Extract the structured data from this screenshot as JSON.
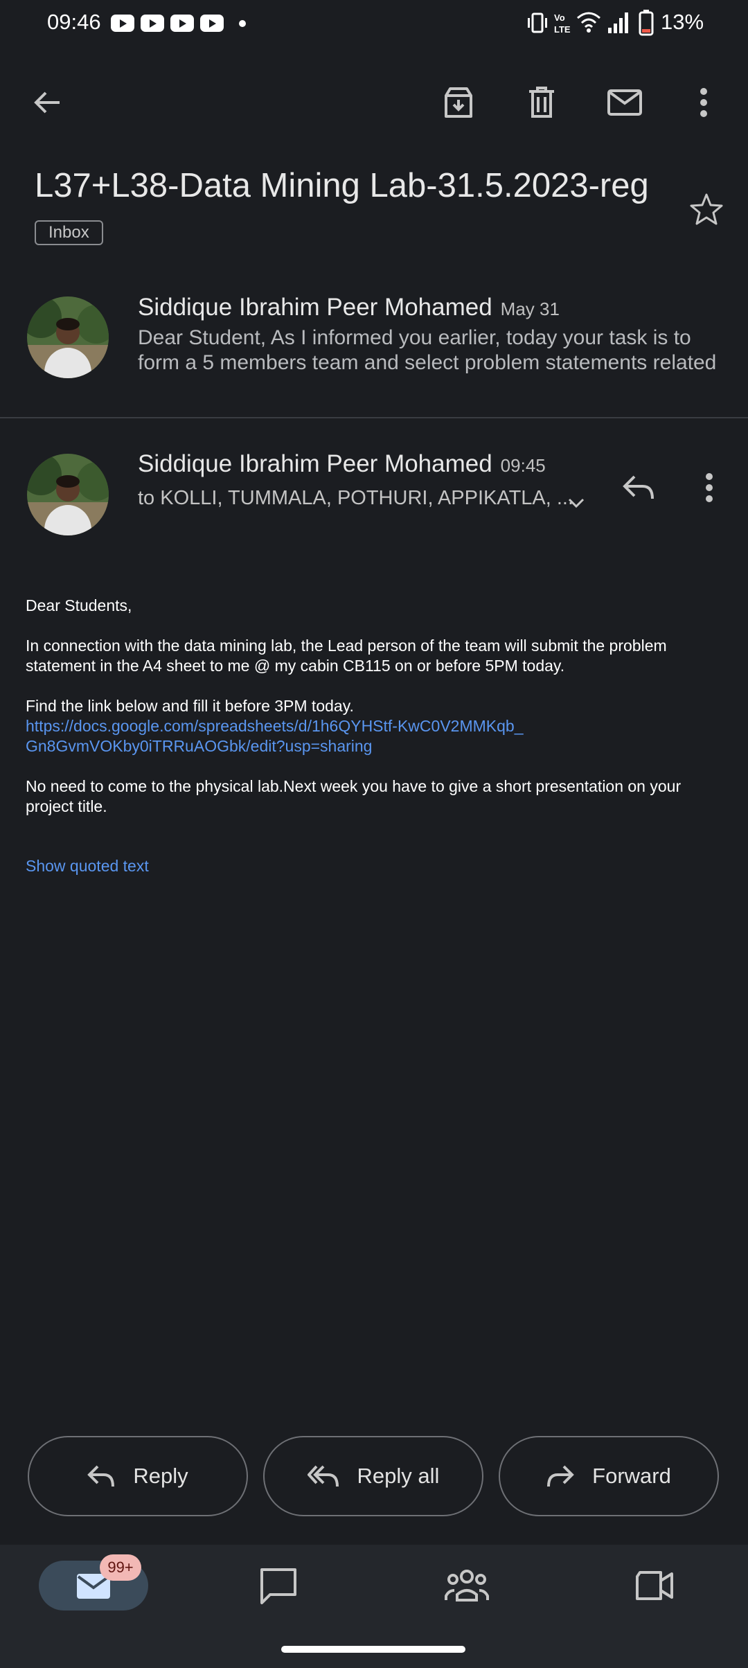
{
  "status_bar": {
    "time": "09:46",
    "battery": "13%"
  },
  "email": {
    "subject": "L37+L38-Data Mining Lab-31.5.2023-reg",
    "label": "Inbox",
    "previous_message": {
      "sender": "Siddique Ibrahim Peer Mohamed",
      "date": "May 31",
      "snippet": "Dear Student, As I informed you earlier, today your task is to form a 5 members team and select problem statements related"
    },
    "current_message": {
      "sender": "Siddique Ibrahim Peer Mohamed",
      "time": "09:45",
      "recipients": "to KOLLI, TUMMALA, POTHURI, APPIKATLA, ...",
      "greeting": "Dear Students,",
      "paragraph1": "In connection with the data mining lab, the Lead person of the team will submit the problem statement in the A4 sheet to me @ my cabin CB115 on or  before 5PM today.",
      "paragraph2": "Find the link below and fill it before 3PM today.",
      "link_line1": "https://docs.google.com/spreadsheets/d/1h6QYHStf-KwC0V2MMKqb_",
      "link_line2": "Gn8GvmVOKby0iTRRuAOGbk/edit?usp=sharing",
      "paragraph3": "No need to come to the physical lab.Next week you have to give a short presentation on your project title.",
      "show_quoted": "Show quoted text"
    }
  },
  "actions": {
    "reply": "Reply",
    "reply_all": "Reply all",
    "forward": "Forward"
  },
  "bottom_nav": {
    "mail_badge": "99+"
  },
  "icons": [
    "back-arrow-icon",
    "archive-icon",
    "delete-icon",
    "mark-unread-icon",
    "more-vert-icon",
    "star-icon",
    "reply-icon",
    "reply-all-icon",
    "forward-icon",
    "mail-icon",
    "chat-icon",
    "spaces-icon",
    "meet-icon"
  ],
  "colors": {
    "background": "#1b1d21",
    "link": "#5a96f0",
    "badge": "#f2b8b5",
    "nav_active": "#3b4b5a"
  }
}
